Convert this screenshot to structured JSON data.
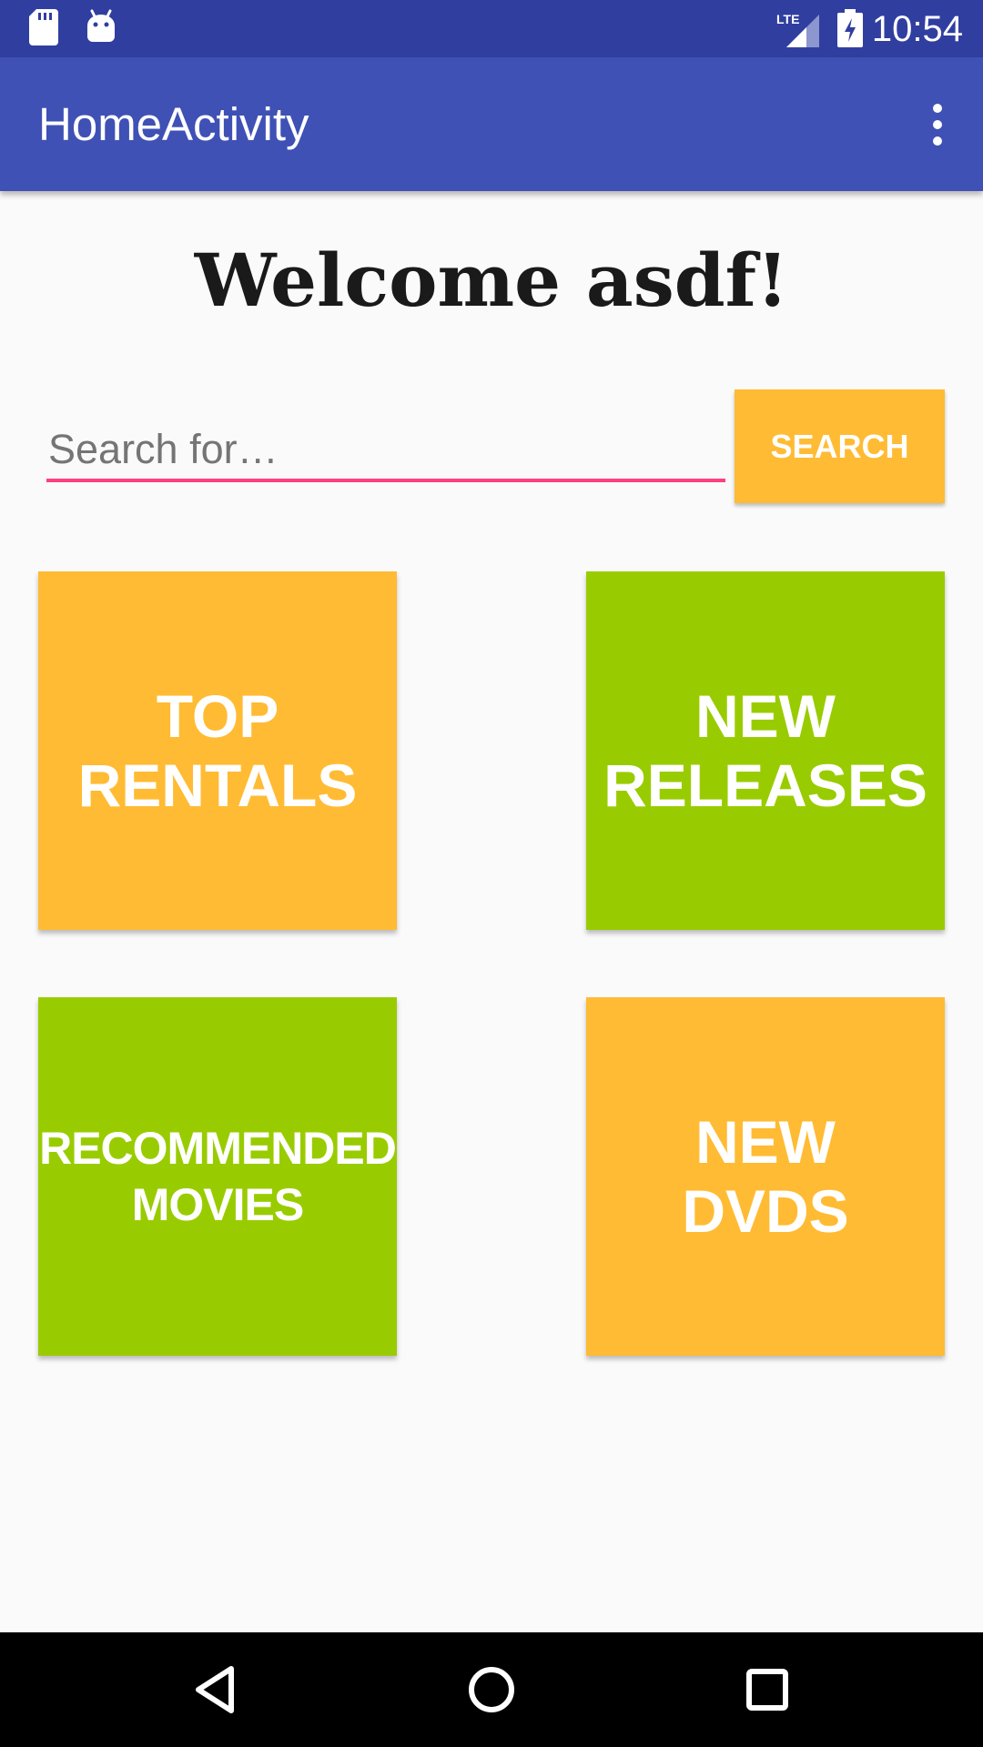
{
  "status_bar": {
    "time": "10:54",
    "left_icons": [
      "sd-card-icon",
      "android-icon"
    ],
    "right_icons": [
      "lte-signal-icon",
      "battery-charging-icon"
    ],
    "network_label": "LTE",
    "background": "#303f9f"
  },
  "app_bar": {
    "title": "HomeActivity",
    "menu_icon": "more-vert-icon",
    "background": "#3f51b5"
  },
  "main": {
    "welcome": "Welcome asdf!",
    "search": {
      "placeholder": "Search for…",
      "value": "",
      "button_label": "SEARCH",
      "underline_color": "#ff4081",
      "button_color": "#ffbb33"
    },
    "tiles": [
      {
        "label": "TOP\nRENTALS",
        "color": "#ffbb33"
      },
      {
        "label": "NEW\nRELEASES",
        "color": "#99cc00"
      },
      {
        "label": "RECOMMENDED\nMOVIES",
        "color": "#99cc00"
      },
      {
        "label": "NEW\nDVDS",
        "color": "#ffbb33"
      }
    ]
  },
  "nav_bar": {
    "buttons": [
      "back-icon",
      "home-icon",
      "recents-icon"
    ]
  }
}
